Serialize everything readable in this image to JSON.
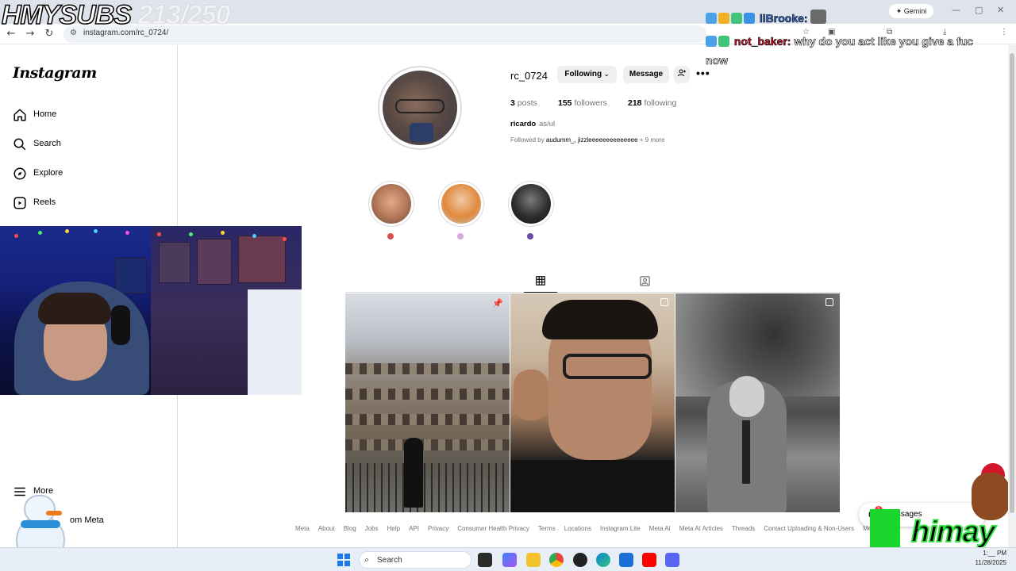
{
  "stream_overlay": {
    "sub_label": "HMYSUBS",
    "sub_count": "213/250",
    "chat": [
      {
        "user": "llBrooke:",
        "message": "",
        "color": "#3b6fd6"
      },
      {
        "user": "not_baker:",
        "message": "why do you act like you give a fuc",
        "color": "#d3132b"
      }
    ],
    "chat_continued": "now",
    "brand": "himay"
  },
  "browser": {
    "url": "instagram.com/rc_0724/",
    "gemini_label": "Gemini"
  },
  "sidebar": {
    "logo": "Instagram",
    "items": [
      {
        "label": "Home",
        "icon": "home-icon"
      },
      {
        "label": "Search",
        "icon": "search-icon"
      },
      {
        "label": "Explore",
        "icon": "explore-icon"
      },
      {
        "label": "Reels",
        "icon": "reels-icon"
      }
    ],
    "more_label": "More",
    "from_meta_label": "om Meta"
  },
  "profile": {
    "username": "rc_0724",
    "following_label": "Following",
    "message_label": "Message",
    "posts_count": "3",
    "posts_label": "posts",
    "followers_count": "155",
    "followers_label": "followers",
    "following_count": "218",
    "following_text": "following",
    "full_name": "ricardo",
    "pronouns": "as/ul",
    "followed_by_prefix": "Followed by",
    "followed_by_names": "audumm_, jizzleeeeeeeeeeeeee",
    "followed_by_more": "+ 9 more"
  },
  "highlights": [
    {
      "color": "#c79a7c",
      "dot": "#d94f4f"
    },
    {
      "color": "#e2b08e",
      "dot": "#d8a8e0"
    },
    {
      "color": "#4a4a4a",
      "dot": "#6b4ba8"
    }
  ],
  "footer": {
    "links": [
      "Meta",
      "About",
      "Blog",
      "Jobs",
      "Help",
      "API",
      "Privacy",
      "Consumer Health Privacy",
      "Terms",
      "Locations",
      "Instagram Lite",
      "Meta AI",
      "Meta AI Articles",
      "Threads",
      "Contact Uploading & Non-Users",
      "Meta V"
    ]
  },
  "messages": {
    "label": "Messages",
    "badge": "1"
  },
  "taskbar": {
    "search_placeholder": "Search",
    "time": "1:__ PM",
    "date": "11/28/2025"
  },
  "colors": {
    "accent": "#0095f6",
    "border": "#dbdbdb",
    "muted_text": "#737373"
  }
}
